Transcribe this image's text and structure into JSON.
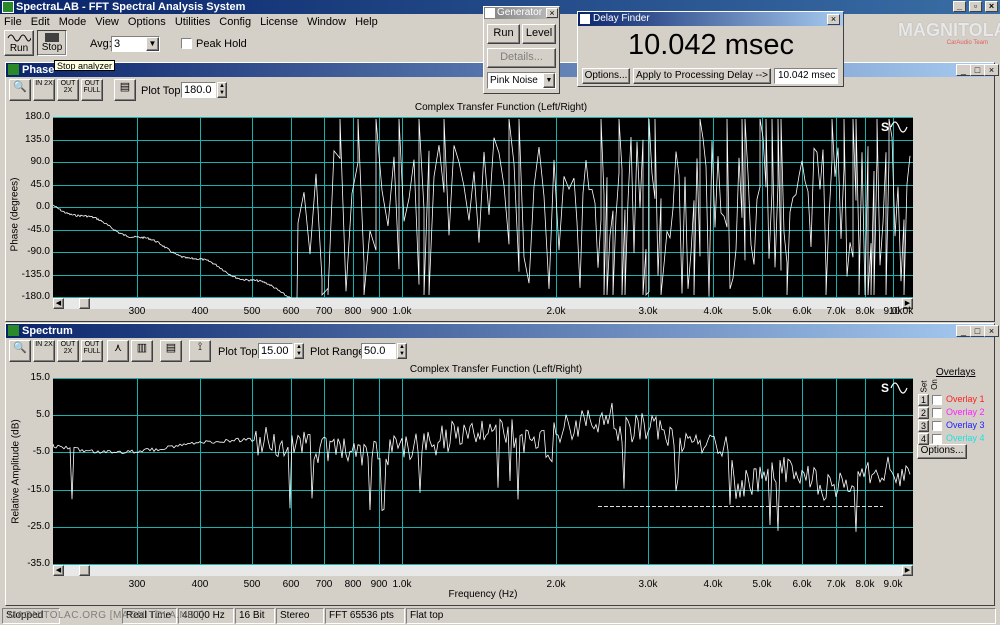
{
  "app": {
    "title": "SpectraLAB - FFT Spectral Analysis System",
    "menu": [
      "File",
      "Edit",
      "Mode",
      "View",
      "Options",
      "Utilities",
      "Config",
      "License",
      "Window",
      "Help"
    ]
  },
  "toolbar": {
    "run_label": "Run",
    "stop_label": "Stop",
    "tooltip": "Stop analyzer",
    "avg_label": "Avg:",
    "avg_value": "3",
    "peak_hold_label": "Peak Hold"
  },
  "generator": {
    "title": "Generator",
    "run_label": "Run",
    "level_label": "Level",
    "details_label": "Details...",
    "noise_value": "Pink Noise"
  },
  "delay_finder": {
    "title": "Delay Finder",
    "value": "10.042 msec",
    "options_label": "Options...",
    "apply_label": "Apply to Processing Delay -->",
    "field_value": "10.042 msec"
  },
  "watermark": {
    "main": "MAGNITOLA",
    "sub": "CarAudio Team"
  },
  "phase": {
    "title": "Phase",
    "plot_top_label": "Plot Top:",
    "plot_top_value": "180.0",
    "chart_title": "Complex Transfer Function (Left/Right)",
    "ylabel": "Phase (degrees)",
    "yticks": [
      "180.0",
      "135.0",
      "90.0",
      "45.0",
      "0.0",
      "-45.0",
      "-90.0",
      "-135.0",
      "-180.0"
    ],
    "xticks": [
      "300",
      "400",
      "500",
      "600",
      "700",
      "800",
      "900",
      "1.0k",
      "2.0k",
      "3.0k",
      "4.0k",
      "5.0k",
      "6.0k",
      "7.0k",
      "8.0k",
      "9.0k",
      "10.0k"
    ]
  },
  "spectrum": {
    "title": "Spectrum",
    "plot_top_label": "Plot Top:",
    "plot_top_value": "15.00",
    "plot_range_label": "Plot Range:",
    "plot_range_value": "50.0",
    "chart_title": "Complex Transfer Function (Left/Right)",
    "ylabel": "Relative Amplitude (dB)",
    "xlabel": "Frequency (Hz)",
    "yticks": [
      "15.0",
      "5.0",
      "-5.0",
      "-15.0",
      "-25.0",
      "-35.0"
    ],
    "xticks": [
      "300",
      "400",
      "500",
      "600",
      "700",
      "800",
      "900",
      "1.0k",
      "2.0k",
      "3.0k",
      "4.0k",
      "5.0k",
      "6.0k",
      "7.0k",
      "8.0k",
      "9.0k"
    ]
  },
  "overlays": {
    "title": "Overlays",
    "col_set": "Set",
    "col_on": "On",
    "items": [
      {
        "num": "1",
        "label": "Overlay 1",
        "color": "#ff2020"
      },
      {
        "num": "2",
        "label": "Overlay 2",
        "color": "#ff20ff"
      },
      {
        "num": "3",
        "label": "Overlay 3",
        "color": "#2020ff"
      },
      {
        "num": "4",
        "label": "Overlay 4",
        "color": "#20e0e0"
      }
    ],
    "options_label": "Options..."
  },
  "status": {
    "cells": [
      "Stopped",
      "Real Time",
      "48000 Hz",
      "16 Bit",
      "Stereo",
      "FFT 65536 pts",
      "Flat top"
    ],
    "watermark_text": "MAGNITOLAC.ORG [MAGNITOLA.NET]"
  },
  "colors": {
    "grid": "#1ab0b0",
    "trace": "#ffffff",
    "title_active": "#0a246a"
  }
}
